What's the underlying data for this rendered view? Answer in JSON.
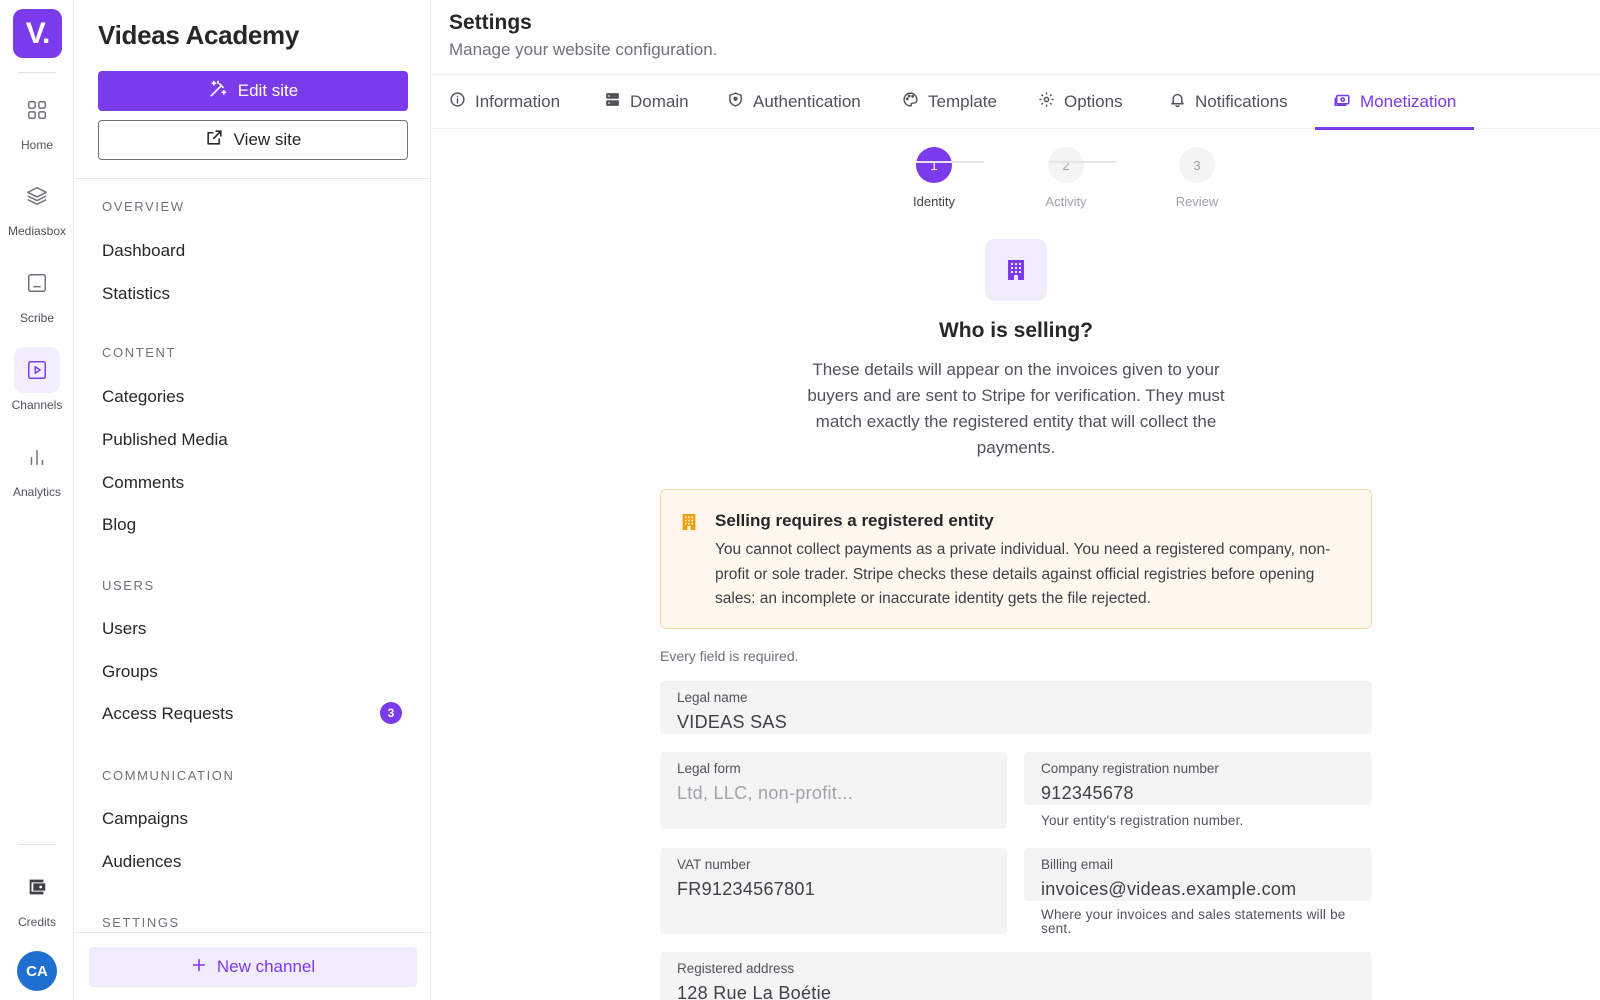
{
  "rail": {
    "logo": "V.",
    "items": [
      {
        "label": "Home",
        "icon": "grid-icon"
      },
      {
        "label": "Mediasbox",
        "icon": "layers-icon"
      },
      {
        "label": "Scribe",
        "icon": "scribe-icon"
      },
      {
        "label": "Channels",
        "icon": "play-square-icon",
        "active": true
      },
      {
        "label": "Analytics",
        "icon": "bar-chart-icon"
      }
    ],
    "credits": {
      "label": "Credits",
      "icon": "wallet-icon"
    },
    "avatar": "CA",
    "avatar_color": "#1e6fd0"
  },
  "sidebar": {
    "site_title": "Videas Academy",
    "edit_label": "Edit site",
    "view_label": "View site",
    "sections": [
      {
        "title": "OVERVIEW",
        "items": [
          {
            "label": "Dashboard"
          },
          {
            "label": "Statistics"
          }
        ]
      },
      {
        "title": "CONTENT",
        "items": [
          {
            "label": "Categories"
          },
          {
            "label": "Published Media"
          },
          {
            "label": "Comments"
          },
          {
            "label": "Blog"
          }
        ]
      },
      {
        "title": "USERS",
        "items": [
          {
            "label": "Users"
          },
          {
            "label": "Groups"
          },
          {
            "label": "Access Requests",
            "badge": "3"
          }
        ]
      },
      {
        "title": "COMMUNICATION",
        "items": [
          {
            "label": "Campaigns"
          },
          {
            "label": "Audiences"
          }
        ]
      },
      {
        "title": "SETTINGS",
        "items": []
      }
    ],
    "new_channel_label": "New channel"
  },
  "header": {
    "title": "Settings",
    "subtitle": "Manage your website configuration."
  },
  "tabs": [
    {
      "label": "Information",
      "icon": "info-icon"
    },
    {
      "label": "Domain",
      "icon": "server-icon"
    },
    {
      "label": "Authentication",
      "icon": "shield-icon"
    },
    {
      "label": "Template",
      "icon": "palette-icon"
    },
    {
      "label": "Options",
      "icon": "gear-icon"
    },
    {
      "label": "Notifications",
      "icon": "bell-icon"
    },
    {
      "label": "Monetization",
      "icon": "money-icon",
      "active": true
    }
  ],
  "stepper": [
    {
      "number": "1",
      "label": "Identity",
      "active": true
    },
    {
      "number": "2",
      "label": "Activity"
    },
    {
      "number": "3",
      "label": "Review"
    }
  ],
  "identity": {
    "icon": "building-icon",
    "title": "Who is selling?",
    "description": "These details will appear on the invoices given to your buyers and are sent to Stripe for verification. They must match exactly the registered entity that will collect the payments.",
    "alert": {
      "title": "Selling requires a registered entity",
      "text": "You cannot collect payments as a private individual. You need a registered company, non-profit or sole trader. Stripe checks these details against official registries before opening sales: an incomplete or inaccurate identity gets the file rejected."
    },
    "required_note": "Every field is required.",
    "fields": {
      "legal_name": {
        "label": "Legal name",
        "value": "VIDEAS SAS"
      },
      "legal_form": {
        "label": "Legal form",
        "value": "",
        "placeholder": "Ltd, LLC, non-profit..."
      },
      "registration_number": {
        "label": "Company registration number",
        "value": "912345678",
        "hint": "Your entity's registration number."
      },
      "vat_number": {
        "label": "VAT number",
        "value": "FR91234567801"
      },
      "billing_email": {
        "label": "Billing email",
        "value": "invoices@videas.example.com",
        "hint": "Where your invoices and sales statements will be sent."
      },
      "registered_address": {
        "label": "Registered address",
        "value": "128 Rue La Boétie"
      }
    }
  },
  "colors": {
    "accent": "#7c3aed",
    "accent_light": "#f1ebfe",
    "alert_bg": "#fff8ee",
    "alert_border": "#fbd7a8",
    "alert_icon": "#f59e0b"
  }
}
